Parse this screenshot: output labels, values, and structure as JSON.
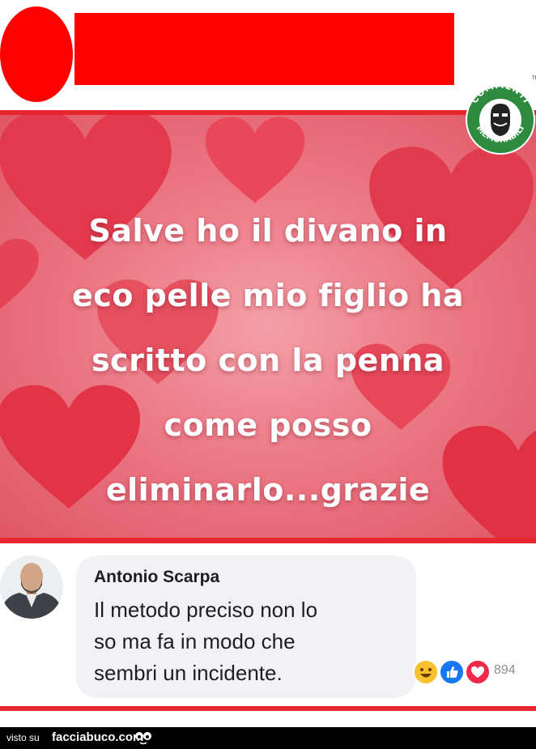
{
  "post": {
    "lines": [
      "Salve ho il divano in",
      "eco pelle mio figlio ha",
      "scritto con la penna",
      "come posso",
      "eliminarlo...grazie"
    ]
  },
  "badge": {
    "top_text": "COMMENTI",
    "bottom_text": "MEMORABILI",
    "tm": "TM"
  },
  "comment": {
    "author": "Antonio Scarpa",
    "lines": [
      "Il metodo preciso non lo",
      "so ma fa in modo che",
      "sembri un incidente."
    ],
    "reactions": {
      "icons": [
        "haha-icon",
        "like-icon",
        "love-icon"
      ],
      "count": "894"
    }
  },
  "footer": {
    "prefix": "visto su",
    "site": "facciabuco.com"
  },
  "colors": {
    "redaction": "#fe0000",
    "accent_line": "#e8262f",
    "badge_green": "#2e8b3e"
  }
}
